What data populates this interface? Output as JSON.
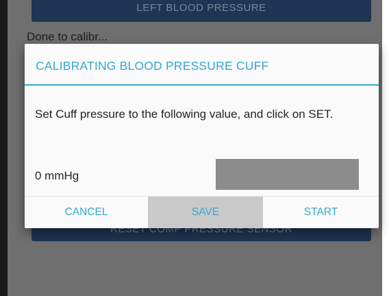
{
  "background": {
    "top_button_label": "Left Blood Pressure",
    "partial_label": "Done to calibr...",
    "bottom_button_label": "RESET COMP PRESSURE SENSOR"
  },
  "dialog": {
    "title": "CALIBRATING BLOOD PRESSURE CUFF",
    "message": "Set Cuff pressure to the following value, and click on SET.",
    "pressure_value": "0 mmHg",
    "pressure_input_value": "",
    "buttons": {
      "cancel": "CANCEL",
      "save": "SAVE",
      "start": "START"
    }
  },
  "colors": {
    "accent": "#33a9d6",
    "scrim": "#6f6f6f",
    "dark_button": "#1e3554",
    "input_fill": "#8c8c8c",
    "pressed_button": "#c9c9c9"
  }
}
